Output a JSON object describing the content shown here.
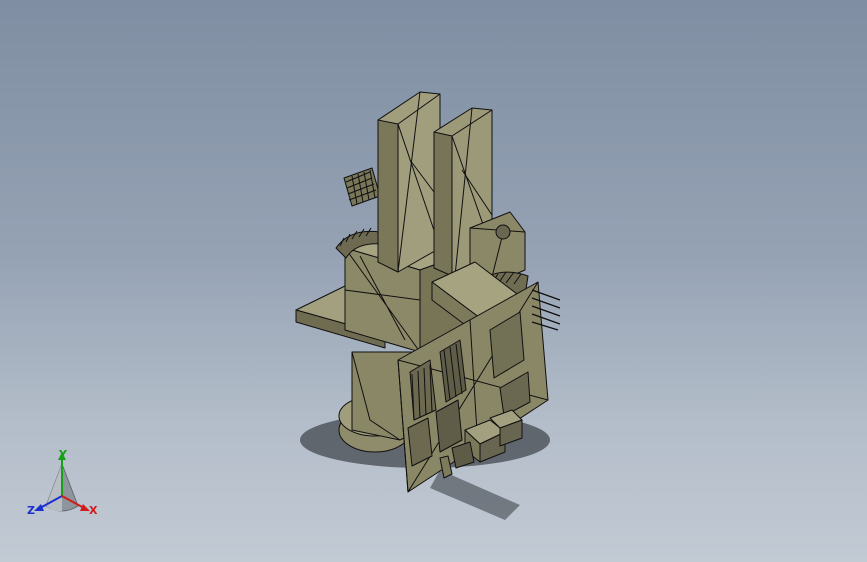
{
  "viewport": {
    "background_top": "#7f8ea2",
    "background_bottom": "#c2cad4",
    "model_face_color": "#8e8c6d",
    "model_edge_color": "#101010"
  },
  "triad": {
    "x_label": "X",
    "y_label": "Y",
    "z_label": "Z",
    "x_color": "#d21c1c",
    "y_color": "#18a018",
    "z_color": "#1c2fd0"
  }
}
